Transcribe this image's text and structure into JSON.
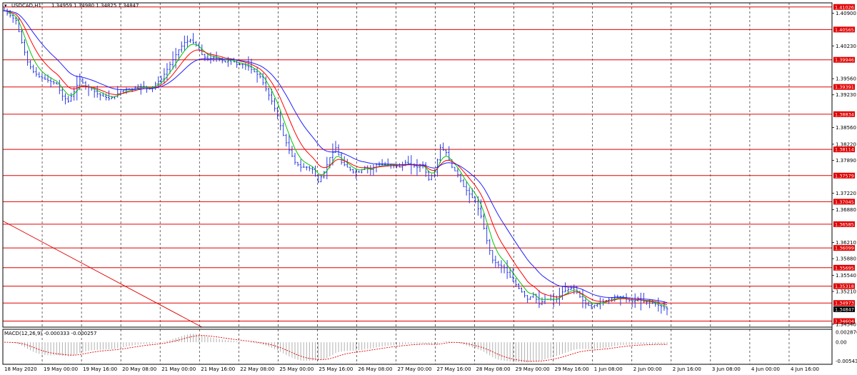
{
  "header": {
    "symbol": "USDCAD,H1",
    "ohlc": "1.34959 1.34980 1.34825 1.34847"
  },
  "macd_label": "MACD(12,26,9) -0.000333 -0.000257",
  "colors": {
    "background": "#ffffff",
    "candles": "#2b3ce0",
    "ma_fast": "#00c800",
    "ma_mid": "#ff0000",
    "ma_slow": "#2020ff",
    "levels": "#e00000",
    "grid": "#000000"
  },
  "chart_data": {
    "type": "line",
    "series_kind": "candlestick",
    "x_tick_labels": [
      "18 May 2020",
      "19 May 00:00",
      "19 May 16:00",
      "20 May 08:00",
      "21 May 00:00",
      "21 May 16:00",
      "22 May 08:00",
      "25 May 00:00",
      "25 May 16:00",
      "26 May 08:00",
      "27 May 00:00",
      "27 May 16:00",
      "28 May 08:00",
      "29 May 00:00",
      "29 May 16:00",
      "1 Jun 08:00",
      "2 Jun 00:00",
      "2 Jun 16:00",
      "3 Jun 08:00",
      "4 Jun 00:00",
      "4 Jun 16:00"
    ],
    "y_tick_labels": [
      "1.40900",
      "1.40230",
      "1.39560",
      "1.39230",
      "1.38560",
      "1.38220",
      "1.37890",
      "1.37220",
      "1.36880",
      "1.36210",
      "1.35880",
      "1.35540",
      "1.35210",
      "1.34540"
    ],
    "price_range": [
      1.3448,
      1.4111
    ],
    "price_path": [
      [
        0,
        1.4095
      ],
      [
        2,
        1.4085
      ],
      [
        4,
        1.4075
      ],
      [
        6,
        1.403
      ],
      [
        8,
        1.399
      ],
      [
        10,
        1.397
      ],
      [
        12,
        1.396
      ],
      [
        14,
        1.3955
      ],
      [
        16,
        1.395
      ],
      [
        18,
        1.3945
      ],
      [
        20,
        1.392
      ],
      [
        22,
        1.391
      ],
      [
        24,
        1.393
      ],
      [
        26,
        1.3955
      ],
      [
        28,
        1.394
      ],
      [
        30,
        1.3935
      ],
      [
        32,
        1.3925
      ],
      [
        34,
        1.392
      ],
      [
        36,
        1.3915
      ],
      [
        38,
        1.392
      ],
      [
        40,
        1.393
      ],
      [
        42,
        1.3935
      ],
      [
        44,
        1.3935
      ],
      [
        46,
        1.394
      ],
      [
        48,
        1.394
      ],
      [
        50,
        1.3935
      ],
      [
        52,
        1.3945
      ],
      [
        54,
        1.3955
      ],
      [
        56,
        1.3975
      ],
      [
        58,
        1.3995
      ],
      [
        60,
        1.4015
      ],
      [
        62,
        1.403
      ],
      [
        64,
        1.4035
      ],
      [
        66,
        1.4025
      ],
      [
        68,
        1.4005
      ],
      [
        70,
        1.3995
      ],
      [
        72,
        1.4
      ],
      [
        74,
        1.3995
      ],
      [
        76,
        1.399
      ],
      [
        78,
        1.3995
      ],
      [
        80,
        1.3985
      ],
      [
        82,
        1.3985
      ],
      [
        84,
        1.398
      ],
      [
        86,
        1.397
      ],
      [
        88,
        1.396
      ],
      [
        90,
        1.3935
      ],
      [
        92,
        1.391
      ],
      [
        94,
        1.388
      ],
      [
        96,
        1.384
      ],
      [
        98,
        1.381
      ],
      [
        100,
        1.3785
      ],
      [
        102,
        1.3775
      ],
      [
        104,
        1.3775
      ],
      [
        106,
        1.377
      ],
      [
        108,
        1.3745
      ],
      [
        110,
        1.3765
      ],
      [
        112,
        1.3795
      ],
      [
        114,
        1.3815
      ],
      [
        116,
        1.3785
      ],
      [
        118,
        1.3775
      ],
      [
        120,
        1.3765
      ],
      [
        122,
        1.3765
      ],
      [
        124,
        1.3775
      ],
      [
        126,
        1.377
      ],
      [
        128,
        1.378
      ],
      [
        130,
        1.378
      ],
      [
        132,
        1.378
      ],
      [
        134,
        1.378
      ],
      [
        136,
        1.3775
      ],
      [
        138,
        1.3785
      ],
      [
        140,
        1.378
      ],
      [
        142,
        1.3775
      ],
      [
        144,
        1.378
      ],
      [
        146,
        1.375
      ],
      [
        148,
        1.3765
      ],
      [
        150,
        1.3815
      ],
      [
        152,
        1.3805
      ],
      [
        154,
        1.3775
      ],
      [
        156,
        1.376
      ],
      [
        158,
        1.3735
      ],
      [
        160,
        1.372
      ],
      [
        162,
        1.3705
      ],
      [
        164,
        1.3675
      ],
      [
        166,
        1.3625
      ],
      [
        168,
        1.3585
      ],
      [
        170,
        1.3575
      ],
      [
        172,
        1.357
      ],
      [
        174,
        1.355
      ],
      [
        176,
        1.3535
      ],
      [
        178,
        1.352
      ],
      [
        180,
        1.3505
      ],
      [
        182,
        1.3515
      ],
      [
        184,
        1.3495
      ],
      [
        186,
        1.3505
      ],
      [
        188,
        1.3505
      ],
      [
        190,
        1.3505
      ],
      [
        192,
        1.352
      ],
      [
        194,
        1.3525
      ],
      [
        196,
        1.353
      ],
      [
        198,
        1.351
      ],
      [
        200,
        1.3495
      ],
      [
        202,
        1.349
      ],
      [
        204,
        1.3495
      ],
      [
        206,
        1.35
      ],
      [
        208,
        1.3505
      ],
      [
        210,
        1.351
      ],
      [
        212,
        1.351
      ],
      [
        214,
        1.3505
      ],
      [
        216,
        1.35
      ],
      [
        218,
        1.3505
      ],
      [
        220,
        1.35
      ],
      [
        222,
        1.35
      ],
      [
        224,
        1.3495
      ],
      [
        226,
        1.349
      ],
      [
        228,
        1.3485
      ]
    ],
    "resistance_levels": [
      {
        "label": "1.41026",
        "value": 1.41026
      },
      {
        "label": "1.40565",
        "value": 1.40565
      },
      {
        "label": "1.39946",
        "value": 1.39946
      },
      {
        "label": "1.39391",
        "value": 1.39391
      },
      {
        "label": "1.38834",
        "value": 1.38834
      },
      {
        "label": "1.38114",
        "value": 1.38114
      },
      {
        "label": "1.37579",
        "value": 1.37579
      },
      {
        "label": "1.37045",
        "value": 1.37045
      },
      {
        "label": "1.36585",
        "value": 1.36585
      },
      {
        "label": "1.36099",
        "value": 1.36099
      },
      {
        "label": "1.35695",
        "value": 1.35695
      },
      {
        "label": "1.35318",
        "value": 1.35318
      },
      {
        "label": "1.34973",
        "value": 1.34973
      },
      {
        "label": "1.34604",
        "value": 1.34604
      }
    ],
    "current_price": {
      "label": "1.34847",
      "value": 1.34847
    },
    "trendline": {
      "from": [
        1.3665,
        0
      ],
      "to": [
        1.3448,
        68
      ]
    },
    "moving_averages": [
      {
        "color": "#00c800",
        "period": 5
      },
      {
        "color": "#ff0000",
        "period": 10
      },
      {
        "color": "#2020ff",
        "period": 20
      }
    ],
    "macd": {
      "y_tick_labels": [
        "0.002876",
        "0.00",
        "-0.005433"
      ],
      "range": [
        -0.0059,
        0.0033
      ]
    }
  }
}
